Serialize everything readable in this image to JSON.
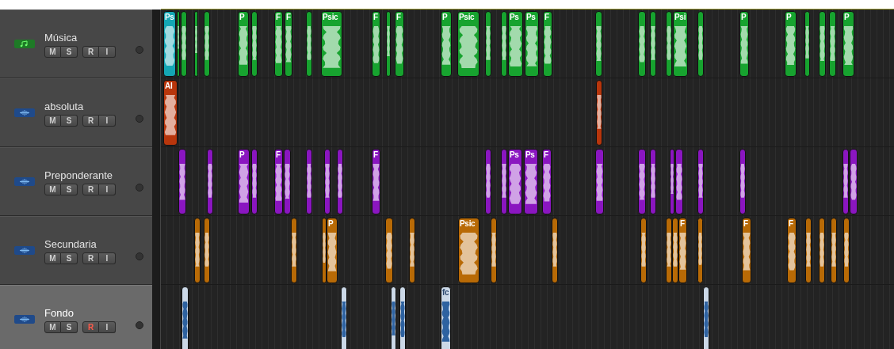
{
  "tracks": [
    {
      "name": "Música",
      "kind": "midi",
      "selected": false,
      "color": "#17a32f",
      "buttons": [
        {
          "label": "M",
          "on": false
        },
        {
          "label": "S",
          "on": false
        },
        {
          "label": "R",
          "on": false
        },
        {
          "label": "I",
          "on": false
        }
      ],
      "regions": [
        {
          "label": "Ps",
          "selected": true
        },
        {
          "selected": false
        },
        {
          "selected": false
        },
        {
          "selected": false
        },
        {
          "selected": false
        },
        {
          "label": "P",
          "selected": false
        },
        {
          "selected": false
        },
        {
          "label": "F",
          "selected": false
        },
        {
          "label": "F",
          "selected": false
        },
        {
          "selected": false
        },
        {
          "label": "Psic",
          "selected": false
        },
        {
          "label": "F",
          "selected": false
        },
        {
          "selected": false
        },
        {
          "label": "F",
          "selected": false
        },
        {
          "label": "P",
          "selected": false
        },
        {
          "label": "Psic",
          "selected": false
        },
        {
          "selected": false
        },
        {
          "selected": false
        },
        {
          "label": "Ps",
          "selected": false
        },
        {
          "label": "Ps",
          "selected": false
        },
        {
          "label": "F",
          "selected": false
        },
        {
          "selected": false
        },
        {
          "selected": false
        },
        {
          "selected": false
        },
        {
          "selected": false
        },
        {
          "label": "Psi",
          "selected": false
        },
        {
          "selected": false
        },
        {
          "label": "P",
          "selected": false
        },
        {
          "label": "P",
          "selected": false
        },
        {
          "selected": false
        },
        {
          "selected": false
        },
        {
          "selected": false
        },
        {
          "label": "P",
          "selected": false
        }
      ]
    },
    {
      "name": "absoluta",
      "kind": "audio",
      "selected": false,
      "color": "#b8360c",
      "buttons": [
        {
          "label": "M",
          "on": false
        },
        {
          "label": "S",
          "on": false
        },
        {
          "label": "R",
          "on": false
        },
        {
          "label": "I",
          "on": false
        }
      ],
      "regions": [
        {
          "label": "Al",
          "selected": false
        },
        {
          "selected": false
        }
      ]
    },
    {
      "name": "Preponderante",
      "kind": "audio",
      "selected": false,
      "color": "#8a16c0",
      "buttons": [
        {
          "label": "M",
          "on": false
        },
        {
          "label": "S",
          "on": false
        },
        {
          "label": "R",
          "on": false
        },
        {
          "label": "I",
          "on": false
        }
      ],
      "regions": [
        {
          "selected": false
        },
        {
          "selected": false
        },
        {
          "label": "P",
          "selected": false
        },
        {
          "selected": false
        },
        {
          "label": "F",
          "selected": false
        },
        {
          "selected": false
        },
        {
          "selected": false
        },
        {
          "selected": false
        },
        {
          "selected": false
        },
        {
          "label": "F",
          "selected": false
        },
        {
          "selected": false
        },
        {
          "selected": false
        },
        {
          "label": "Ps",
          "selected": false
        },
        {
          "label": "Ps",
          "selected": false
        },
        {
          "label": "F",
          "selected": false
        },
        {
          "selected": false
        },
        {
          "selected": false
        },
        {
          "selected": false
        },
        {
          "selected": false
        },
        {
          "selected": false
        },
        {
          "selected": false
        },
        {
          "selected": false
        },
        {
          "selected": false
        },
        {
          "selected": false
        }
      ]
    },
    {
      "name": "Secundaria",
      "kind": "audio",
      "selected": false,
      "color": "#b86a06",
      "buttons": [
        {
          "label": "M",
          "on": false
        },
        {
          "label": "S",
          "on": false
        },
        {
          "label": "R",
          "on": false
        },
        {
          "label": "I",
          "on": false
        }
      ],
      "regions": [
        {
          "selected": false
        },
        {
          "selected": false
        },
        {
          "selected": false
        },
        {
          "selected": false
        },
        {
          "label": "P",
          "selected": false
        },
        {
          "selected": false
        },
        {
          "selected": false
        },
        {
          "label": "Psic",
          "selected": false
        },
        {
          "selected": false
        },
        {
          "selected": false
        },
        {
          "selected": false
        },
        {
          "selected": false
        },
        {
          "selected": false
        },
        {
          "label": "F",
          "selected": false
        },
        {
          "selected": false
        },
        {
          "label": "F",
          "selected": false
        },
        {
          "label": "F",
          "selected": false
        },
        {
          "selected": false
        },
        {
          "selected": false
        },
        {
          "selected": false
        },
        {
          "selected": false
        }
      ]
    },
    {
      "name": "Fondo",
      "kind": "audio",
      "selected": true,
      "color": "#2e62a0",
      "buttons": [
        {
          "label": "M",
          "on": false
        },
        {
          "label": "S",
          "on": false
        },
        {
          "label": "R",
          "on": true
        },
        {
          "label": "I",
          "on": false
        }
      ],
      "regions": [
        {
          "selected": false
        },
        {
          "selected": false
        },
        {
          "selected": false
        },
        {
          "selected": false
        },
        {
          "label": "fc",
          "selected": false
        },
        {
          "selected": false
        }
      ]
    }
  ]
}
